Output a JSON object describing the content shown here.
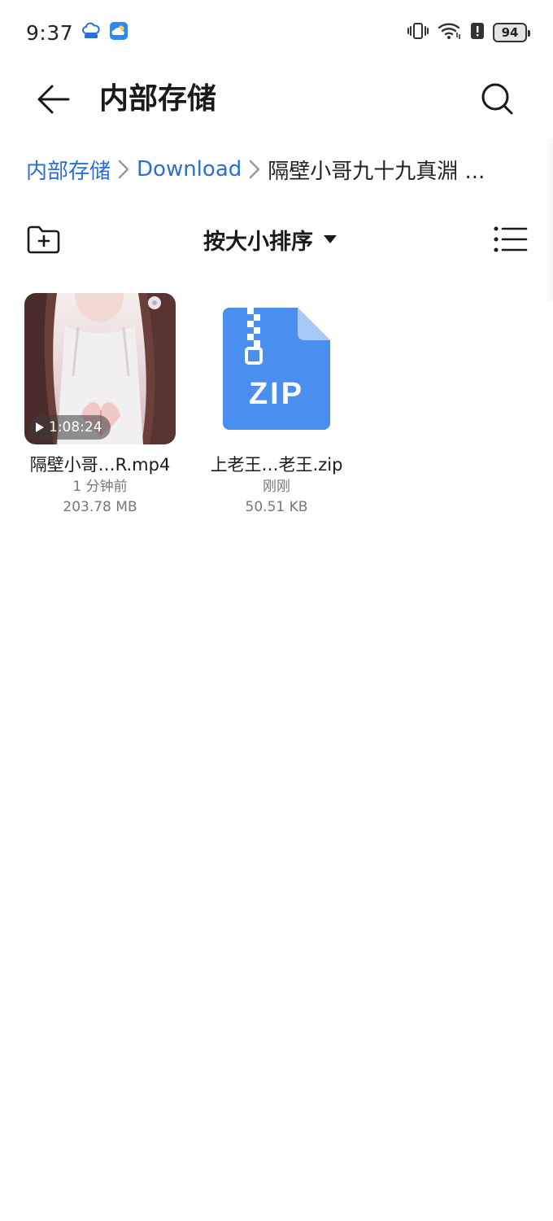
{
  "status_bar": {
    "time": "9:37",
    "battery_level": "94",
    "icons": [
      "cloud-upload-icon",
      "weather-icon",
      "vibrate-icon",
      "wifi-icon",
      "battery-alert-icon",
      "battery-icon"
    ]
  },
  "header": {
    "title": "内部存储",
    "back_icon": "back-arrow-icon",
    "search_icon": "search-icon"
  },
  "breadcrumb": {
    "items": [
      {
        "label": "内部存储",
        "link": true
      },
      {
        "label": "Download",
        "link": true
      },
      {
        "label": "隔壁小哥九十九真淵 ...",
        "link": false
      }
    ]
  },
  "toolbar": {
    "sort_label": "按大小排序",
    "new_folder_icon": "new-folder-icon",
    "list_view_icon": "list-view-icon"
  },
  "files": [
    {
      "name": "隔壁小哥…R.mp4",
      "time": "1 分钟前",
      "size": "203.78 MB",
      "duration": "1:08:24",
      "type": "video"
    },
    {
      "name": "上老王…老王.zip",
      "time": "刚刚",
      "size": "50.51 KB",
      "type": "zip",
      "badge": "ZIP"
    }
  ],
  "colors": {
    "accent": "#2a6fd6",
    "zip_icon": "#4a8ef0",
    "text": "#1a1a1a",
    "meta_text": "#777777"
  }
}
